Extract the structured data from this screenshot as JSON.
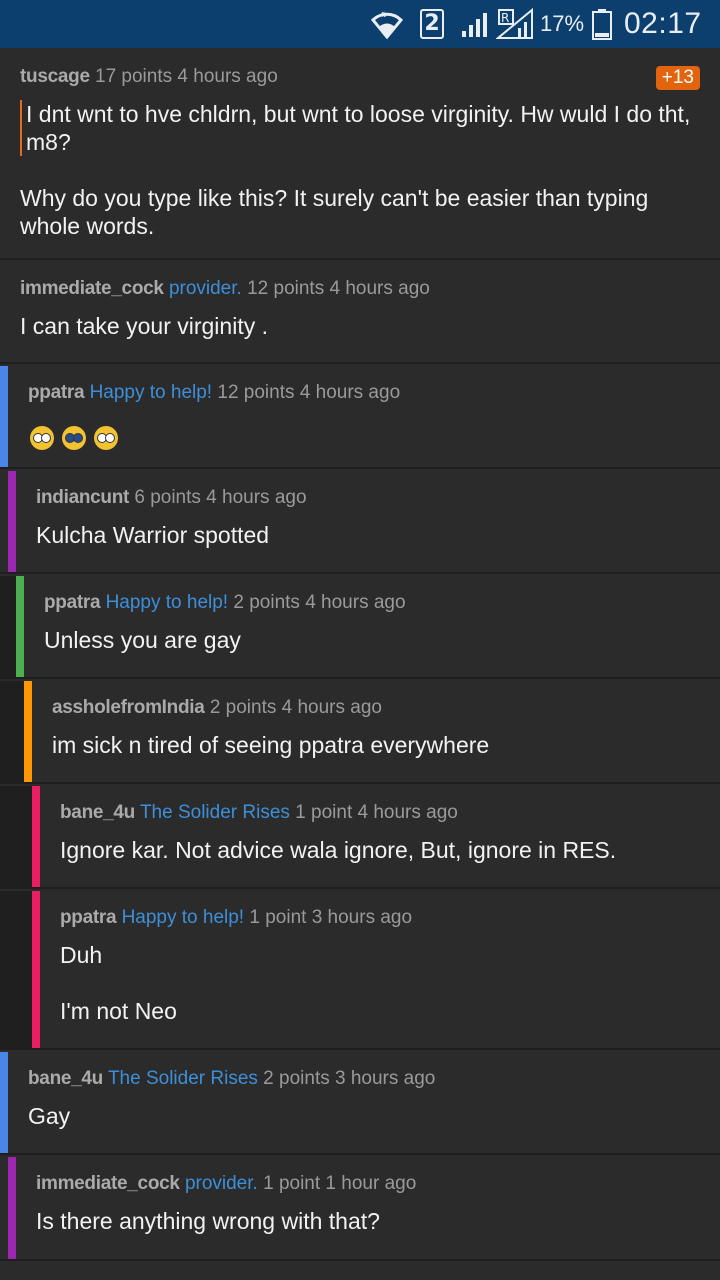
{
  "status_bar": {
    "sim_number": "2",
    "battery_percent": "17%",
    "time": "02:17",
    "icons": [
      "wifi-icon",
      "sim-icon",
      "signal-icon",
      "roaming-signal-icon",
      "battery-icon"
    ]
  },
  "colors": {
    "status_bar_bg": "#0d3f6e",
    "background": "#2b2b2b",
    "flair": "#3d8fd9",
    "depth_1": "#4a86e8",
    "depth_2": "#9c27b0",
    "depth_3": "#4caf50",
    "depth_4": "#ff9800",
    "depth_5": "#e91e63",
    "badge": "#e2640f"
  },
  "comments": [
    {
      "user": "tuscage",
      "flair": "",
      "score": "17 points",
      "age": "4 hours ago",
      "badge": "+13",
      "quote": "I dnt wnt to hve chldrn, but wnt to loose virginity. Hw wuld I do tht, m8?",
      "text": "Why do you type like this? It surely can't be easier than typing whole words."
    },
    {
      "user": "immediate_cock",
      "flair": "provider.",
      "score": "12 points",
      "age": "4 hours ago",
      "text": "I can take your virginity ."
    },
    {
      "user": "ppatra",
      "flair": "Happy to help!",
      "score": "12 points",
      "age": "4 hours ago",
      "emojis": [
        "anguished-emoji",
        "screaming-emoji",
        "fearful-emoji"
      ]
    },
    {
      "user": "indiancunt",
      "flair": "",
      "score": "6 points",
      "age": "4 hours ago",
      "text": "Kulcha Warrior spotted"
    },
    {
      "user": "ppatra",
      "flair": "Happy to help!",
      "score": "2 points",
      "age": "4 hours ago",
      "text": "Unless you are gay"
    },
    {
      "user": "assholefromIndia",
      "flair": "",
      "score": "2 points",
      "age": "4 hours ago",
      "text": "im sick n tired of seeing ppatra everywhere"
    },
    {
      "user": "bane_4u",
      "flair": "The Solider Rises",
      "score": "1 point",
      "age": "4 hours ago",
      "text": "Ignore kar. Not advice wala ignore, But, ignore in RES."
    },
    {
      "user": "ppatra",
      "flair": "Happy to help!",
      "score": "1 point",
      "age": "3 hours ago",
      "text": "Duh",
      "text2": "I'm not Neo"
    },
    {
      "user": "bane_4u",
      "flair": "The Solider Rises",
      "score": "2 points",
      "age": "3 hours ago",
      "text": "Gay"
    },
    {
      "user": "immediate_cock",
      "flair": "provider.",
      "score": "1 point",
      "age": "1 hour ago",
      "text": "Is there anything wrong with that?"
    }
  ]
}
